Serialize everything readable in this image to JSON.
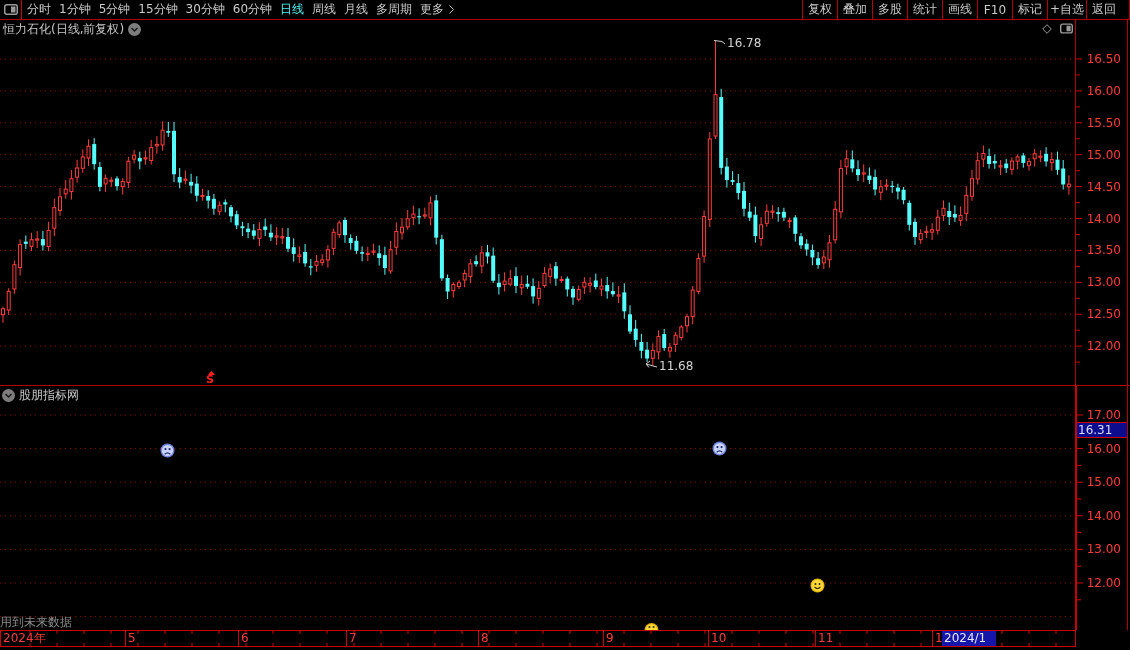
{
  "toolbar": {
    "periods": [
      {
        "label": "分时",
        "selected": false
      },
      {
        "label": "1分钟",
        "selected": false
      },
      {
        "label": "5分钟",
        "selected": false
      },
      {
        "label": "15分钟",
        "selected": false
      },
      {
        "label": "30分钟",
        "selected": false
      },
      {
        "label": "60分钟",
        "selected": false
      },
      {
        "label": "日线",
        "selected": true
      },
      {
        "label": "周线",
        "selected": false
      },
      {
        "label": "月线",
        "selected": false
      },
      {
        "label": "多周期",
        "selected": false
      }
    ],
    "more": "更多",
    "actions": [
      "复权",
      "叠加",
      "多股",
      "统计",
      "画线",
      "F10",
      "标记",
      "+自选",
      "返回"
    ]
  },
  "price_chart": {
    "title": "恒力石化(日线,前复权)",
    "axis_labels": [
      "16.50",
      "16.00",
      "15.50",
      "15.00",
      "14.50",
      "14.00",
      "13.50",
      "13.00",
      "12.50",
      "12.00"
    ],
    "high_label": "16.78",
    "low_label": "11.68",
    "signal_label": "S"
  },
  "indicator_panel": {
    "title": "股朋指标网",
    "axis_labels": [
      "17.00",
      "16.00",
      "15.00",
      "14.00",
      "13.00",
      "12.00"
    ],
    "current_value": "16.31",
    "note": "用到未来数据"
  },
  "date_axis": {
    "labels": [
      "2024年",
      "5",
      "6",
      "7",
      "8",
      "9",
      "10",
      "11",
      "1"
    ],
    "current_date": "2024/1"
  }
}
